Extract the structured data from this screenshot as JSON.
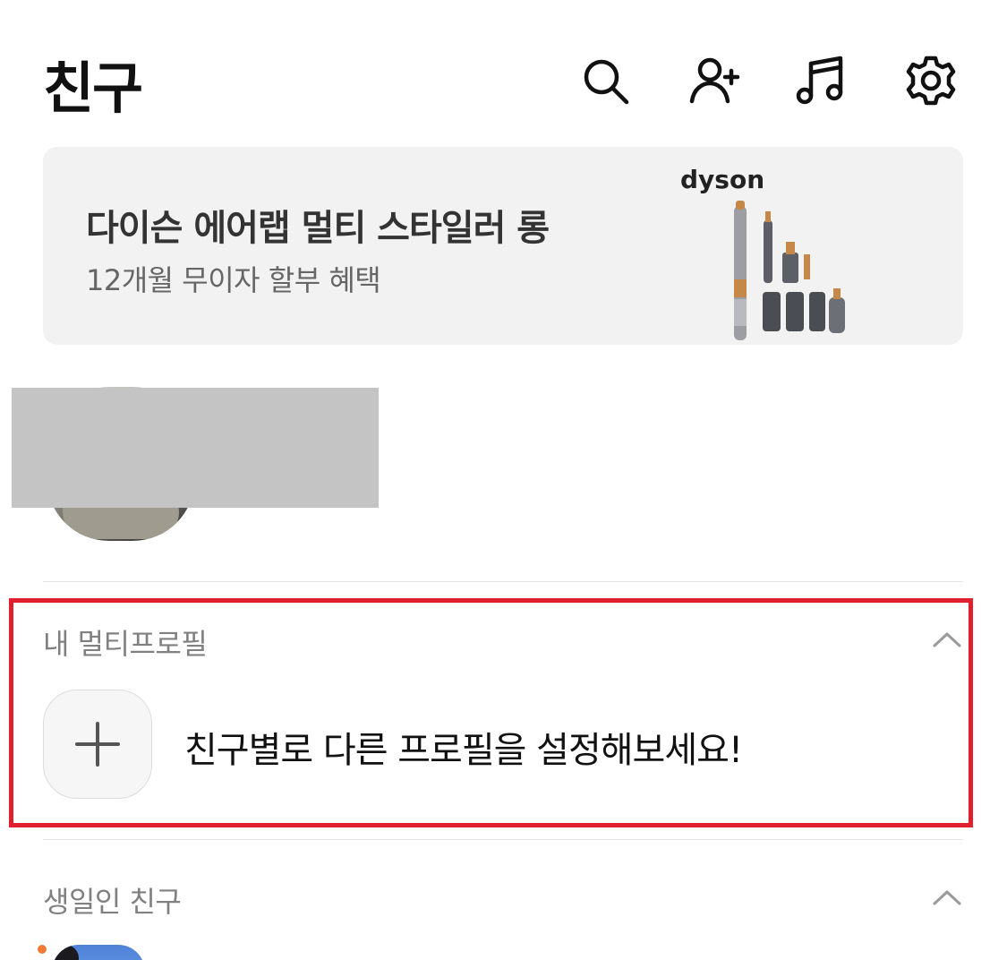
{
  "header": {
    "title": "친구",
    "icons": [
      "search-icon",
      "add-friend-icon",
      "music-icon",
      "settings-icon"
    ]
  },
  "banner": {
    "title": "다이슨 에어랩 멀티 스타일러 롱",
    "subtitle": "12개월 무이자 할부 혜택",
    "brand": "dyson"
  },
  "multi_profile": {
    "section_title": "내 멀티프로필",
    "message": "친구별로 다른 프로필을 설정해보세요!",
    "highlight_color": "#e0202c"
  },
  "birthday": {
    "section_title": "생일인 친구",
    "notification_dot_color": "#f07b35"
  }
}
